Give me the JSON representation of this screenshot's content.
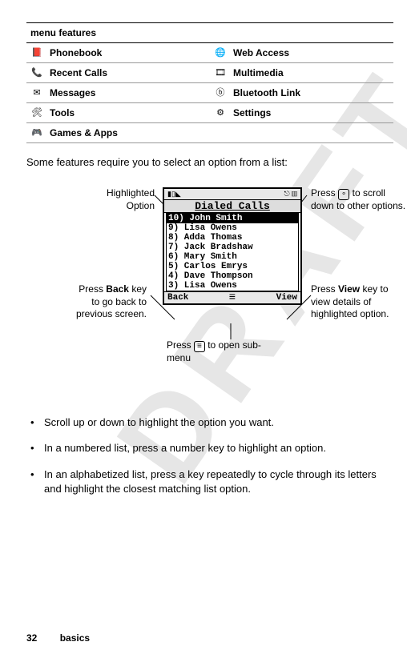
{
  "watermark": "DRAFT",
  "table": {
    "header": "menu features",
    "rows": [
      {
        "left_icon": "📕",
        "left": "Phonebook",
        "right_icon": "🌐",
        "right": "Web Access"
      },
      {
        "left_icon": "📞",
        "left": "Recent Calls",
        "right_icon": "🎞",
        "right": "Multimedia"
      },
      {
        "left_icon": "✉",
        "left": "Messages",
        "right_icon": "ⓑ",
        "right": "Bluetooth Link"
      },
      {
        "left_icon": "🛠",
        "left": "Tools",
        "right_icon": "⚙",
        "right": "Settings"
      },
      {
        "left_icon": "🎮",
        "left": "Games & Apps",
        "right_icon": "",
        "right": ""
      }
    ]
  },
  "intro": "Some features require you to select an option from a list:",
  "phone": {
    "status_left": "▮▯◣",
    "status_right": "⎋ ▥",
    "title": "Dialed Calls",
    "items": [
      "10) John Smith",
      "9) Lisa Owens",
      "8) Adda Thomas",
      "7) Jack Bradshaw",
      "6) Mary Smith",
      "5) Carlos Emrys",
      "4) Dave Thompson",
      "3) Lisa Owens"
    ],
    "softkey_left": "Back",
    "softkey_center": "≡",
    "softkey_right": "View"
  },
  "callouts": {
    "highlighted": "Highlighted Option",
    "press_back_pre": "Press ",
    "press_back_key": "Back",
    "press_back_post": " key to go back to previous screen.",
    "press_scroll_pre": "Press ",
    "press_scroll_glyph": "∘",
    "press_scroll_post": " to scroll down to other options.",
    "press_view_pre": "Press ",
    "press_view_key": "View",
    "press_view_post": " key to view details of highlighted option.",
    "press_menu_pre": "Press ",
    "press_menu_glyph": "≡",
    "press_menu_post": " to open sub-menu"
  },
  "bullets": [
    "Scroll up or down to highlight the option you want.",
    "In a numbered list, press a number key to highlight an option.",
    "In an alphabetized list, press a key repeatedly to cycle through its letters and highlight the closest matching list option."
  ],
  "page_number": "32",
  "section": "basics"
}
